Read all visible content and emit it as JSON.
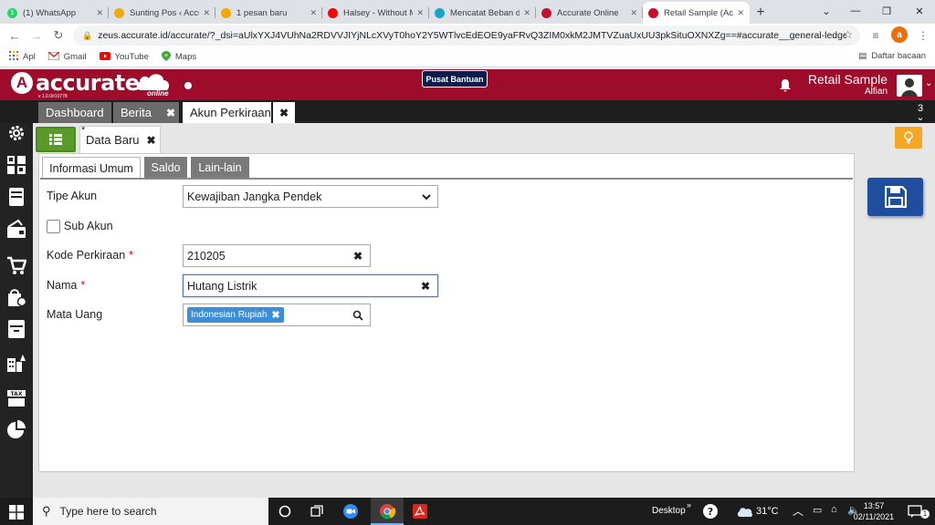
{
  "browser": {
    "tabs": [
      {
        "title": "(1) WhatsApp",
        "icon": "whatsapp-icon",
        "color": "#25d366",
        "glyph": "1"
      },
      {
        "title": "Sunting Pos ‹ Accurate",
        "icon": "accurate-a-icon",
        "color": "#f2a900",
        "glyph": ""
      },
      {
        "title": "1 pesan baru",
        "icon": "accurate-a-icon",
        "color": "#f2a900",
        "glyph": ""
      },
      {
        "title": "Halsey - Without Me",
        "icon": "youtube-icon",
        "color": "#ff0000",
        "glyph": ""
      },
      {
        "title": "Mencatat Beban dan",
        "icon": "site-icon",
        "color": "#1aa3c8",
        "glyph": ""
      },
      {
        "title": "Accurate Online",
        "icon": "accurate-icon",
        "color": "#c8102e",
        "glyph": ""
      },
      {
        "title": "Retail Sample (Accurate)",
        "icon": "accurate-icon",
        "color": "#c8102e",
        "glyph": ""
      }
    ],
    "new_tab": "+",
    "url": "zeus.accurate.id/accurate/?_dsi=aUlxYXJ4VUhNa2RDVVJIYjNLcXVyT0hoY2Y5WTlvcEdEOE9yaFRvQ3ZIM0xkM2JMTVZuaUxUU3pkSituOXNXZg==#accurate__general-ledger__glaccount__form-glaccount",
    "profile_letter": "a",
    "bookmarks": [
      {
        "label": "Apl",
        "icon": "apps-grid-icon"
      },
      {
        "label": "Gmail",
        "icon": "gmail-icon"
      },
      {
        "label": "YouTube",
        "icon": "youtube-icon"
      },
      {
        "label": "Maps",
        "icon": "maps-icon"
      }
    ],
    "reading_list": "Daftar bacaan"
  },
  "app": {
    "brand": "accurate",
    "brand_suffix": "online",
    "version": "v 1.0.0#10778",
    "help_button": "Pusat Bantuan",
    "company": "Retail Sample",
    "user": "Alfian",
    "accent": "#9e0b2b",
    "tabs": [
      {
        "label": "Dashboard"
      },
      {
        "label": "Berita"
      },
      {
        "label": "Akun Perkiraan"
      }
    ],
    "tab_count": "3",
    "data_tab": "Data Baru",
    "data_tab_modified": "*"
  },
  "form": {
    "subtabs": [
      "Informasi Umum",
      "Saldo",
      "Lain-lain"
    ],
    "fields": {
      "account_type": {
        "label": "Tipe Akun",
        "value": "Kewajiban Jangka Pendek"
      },
      "sub_account": {
        "label": "Sub Akun",
        "checked": false
      },
      "account_code": {
        "label": "Kode Perkiraan",
        "value": "210205",
        "required": "*"
      },
      "name": {
        "label": "Nama",
        "value": "Hutang Listrik",
        "required": "*"
      },
      "currency": {
        "label": "Mata Uang",
        "value": "Indonesian Rupiah"
      }
    }
  },
  "taskbar": {
    "search_placeholder": "Type here to search",
    "desktop_label": "Desktop",
    "weather": "31°C",
    "time": "13:57",
    "date": "02/11/2021",
    "notifications": "1"
  }
}
